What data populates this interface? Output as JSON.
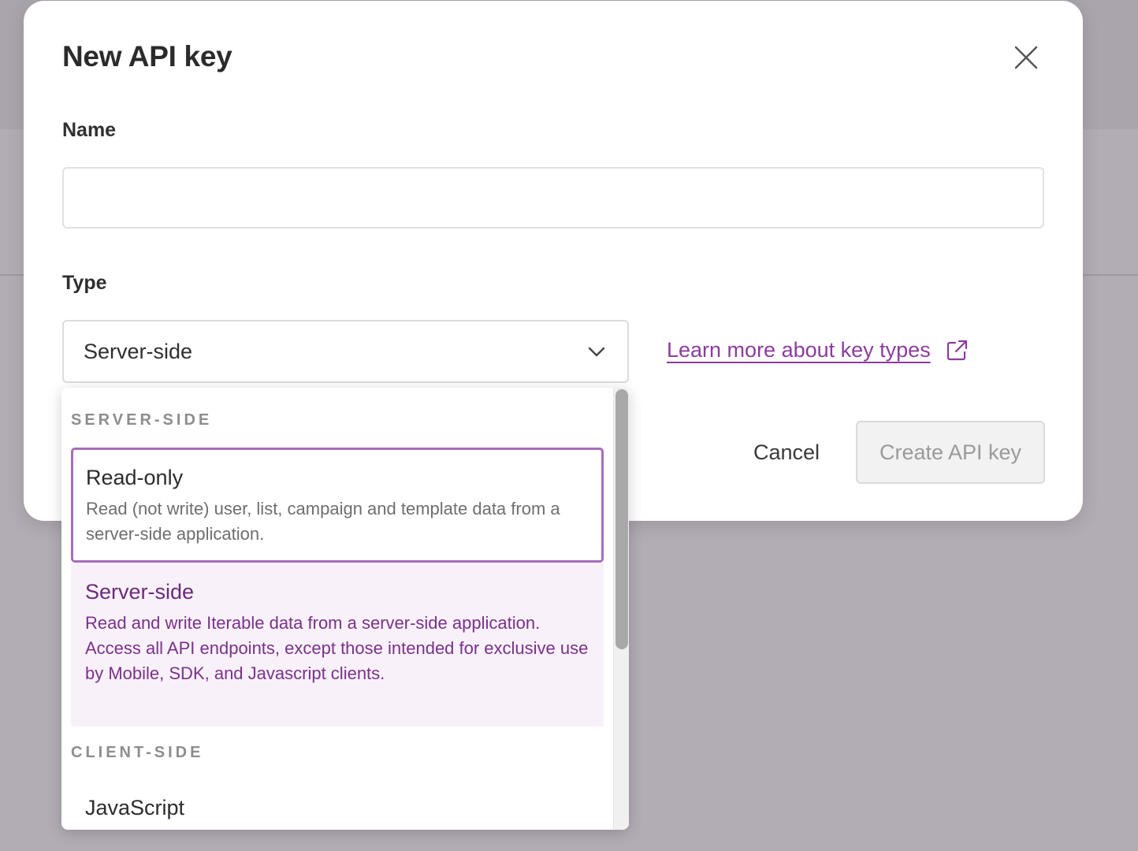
{
  "modal": {
    "title": "New API key",
    "close_icon": "close-icon"
  },
  "form": {
    "name_label": "Name",
    "name_value": "",
    "name_placeholder": "",
    "type_label": "Type",
    "type_selected": "Server-side",
    "learn_more_text": "Learn more about key types",
    "learn_more_icon": "external-link-icon"
  },
  "actions": {
    "cancel_label": "Cancel",
    "create_label": "Create API key"
  },
  "dropdown": {
    "groups": [
      {
        "heading": "SERVER-SIDE",
        "options": [
          {
            "title": "Read-only",
            "description": "Read (not write) user, list, campaign and template data from a server-side application."
          },
          {
            "title": "Server-side",
            "description": "Read and write Iterable data from a server-side application. Access all API endpoints, except those intended for exclusive use by Mobile, SDK, and Javascript clients."
          }
        ]
      },
      {
        "heading": "CLIENT-SIDE",
        "options": [
          {
            "title": "JavaScript",
            "description": ""
          }
        ]
      }
    ]
  },
  "colors": {
    "accent": "#8c3c9e",
    "focus_border": "#a96cbc",
    "selected_bg": "#f9f1fa",
    "overlay": "#b2acb4"
  }
}
